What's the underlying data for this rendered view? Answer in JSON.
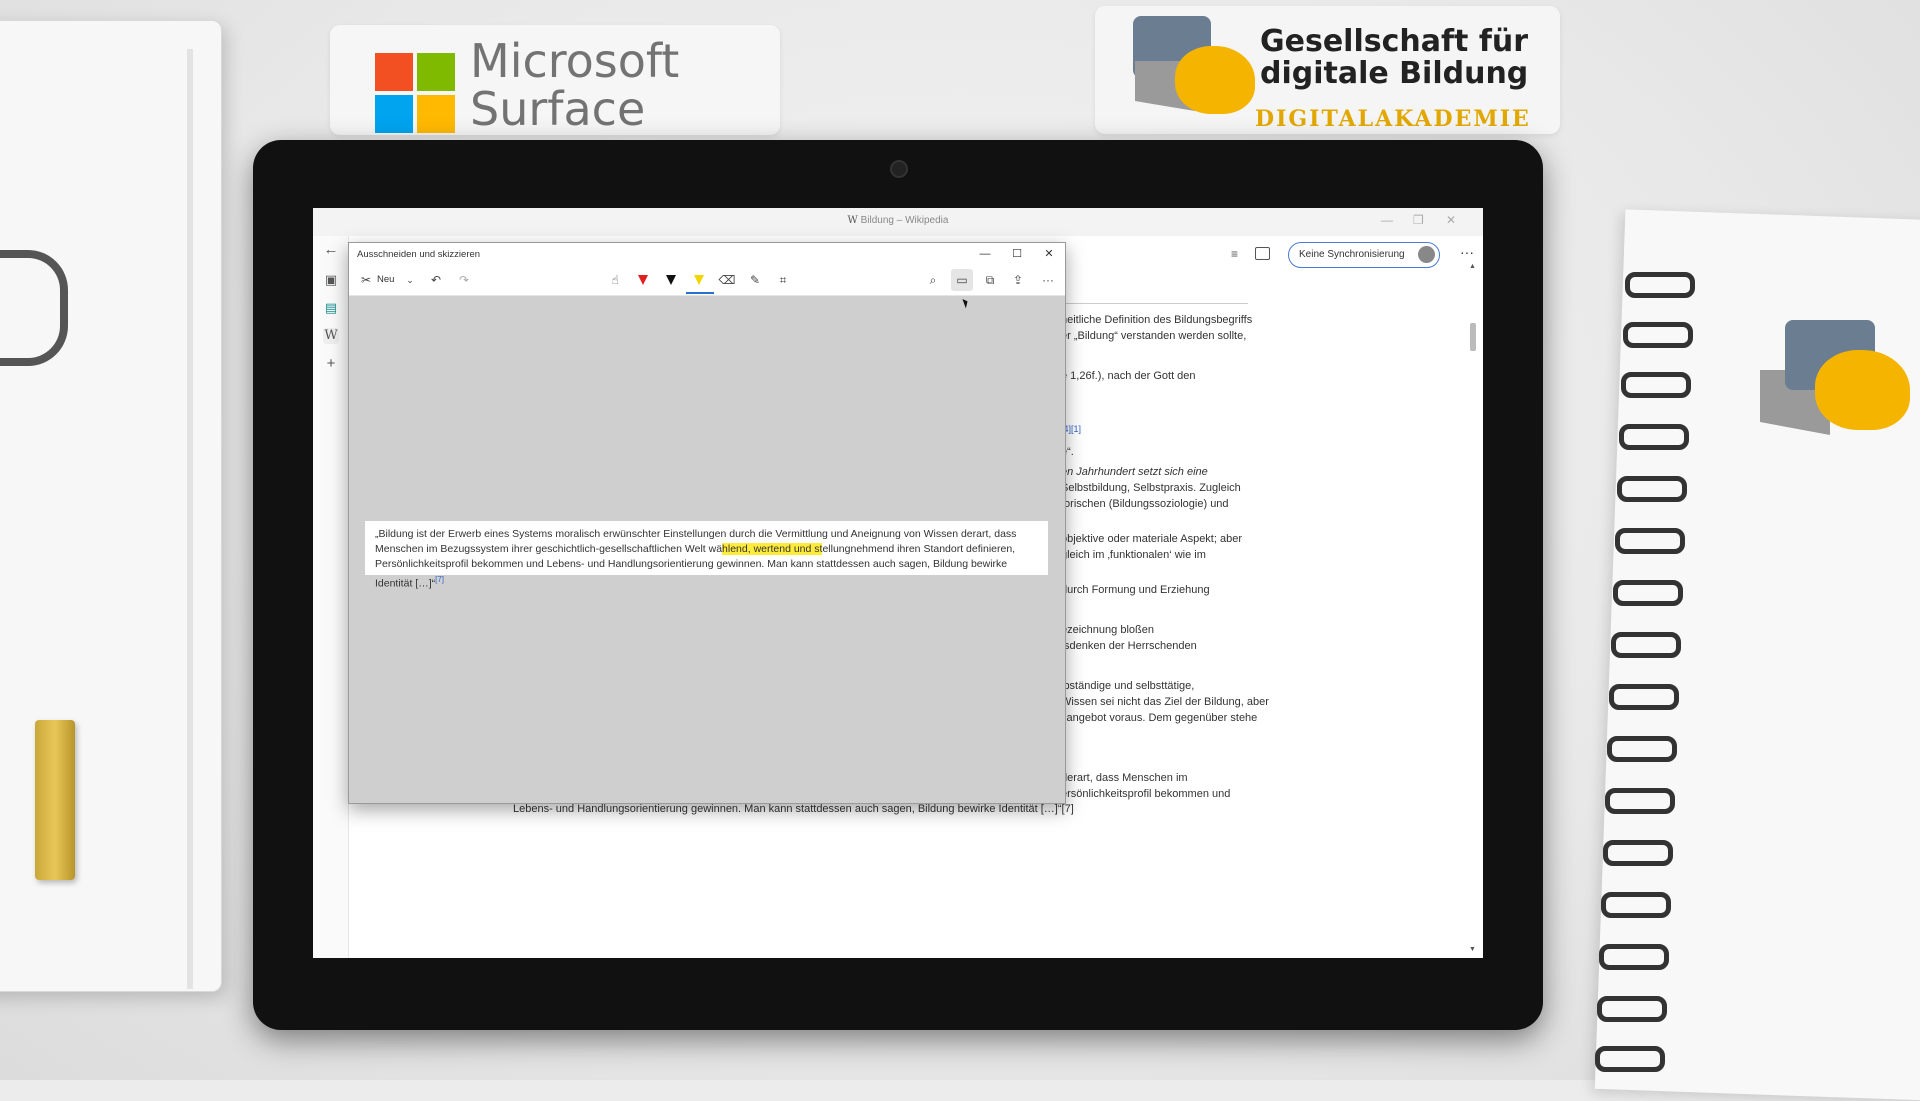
{
  "stickers": {
    "microsoft": {
      "line1": "Microsoft",
      "line2": "Surface"
    },
    "gdb": {
      "line1": "Gesellschaft für",
      "line2": "digitale Bildung",
      "line3": "DIGITALAKADEMIE"
    }
  },
  "browser": {
    "title": "Bildung – Wikipedia",
    "sync_label": "Keine Synchronisierung",
    "more": "···",
    "wiki_lines": [
      "heitliche Definition des Bildungsbegriffs",
      "er „Bildung“ verstanden werden sollte,",
      "e 1,26f.), nach der Gott den",
      "[4][1]",
      "e“.",
      "en Jahrhundert setzt sich eine",
      "Selbstbildung, Selbstpraxis. Zugleich",
      "torischen (Bildungssoziologie) und",
      " objektive oder materiale Aspekt; aber",
      "gleich im ‚funktionalen‘ wie im",
      " durch Formung und Erziehung",
      "ezeichnung bloßen",
      "tsdenken der Herrschenden",
      "lbständige und selbsttätige,",
      "Wissen sei nicht das Ziel der Bildung, aber",
      "sangebot voraus. Dem gegenüber stehe",
      "derart, dass Menschen im",
      "ersönlichkeitsprofil bekommen und",
      "Lebens- und Handlungsorientierung gewinnen. Man kann stattdessen auch sagen, Bildung bewirke Identität […]“[7]"
    ]
  },
  "snip": {
    "title": "Ausschneiden und skizzieren",
    "new_label": "Neu",
    "minimize": "—",
    "maximize": "☐",
    "close": "✕",
    "text_before_hl": "„Bildung ist der Erwerb eines Systems moralisch erwünschter Einstellungen durch die Vermittlung und Aneignung von Wissen derart, dass Menschen im Bezugssystem ihrer geschichtlich-gesellschaftlichen Welt wä",
    "text_hl": "hlend, wertend und st",
    "text_after_hl": "ellungnehmend ihren Standort definieren, Persönlichkeitsprofil bekommen und Lebens- und Handlungsorientierung gewinnen. Man kann stattdessen auch sagen, Bildung bewirke Identität […]“",
    "footnote": "[7]",
    "pen_colors": {
      "red": "#e02020",
      "black": "#111111",
      "yellow": "#f2d600"
    }
  }
}
